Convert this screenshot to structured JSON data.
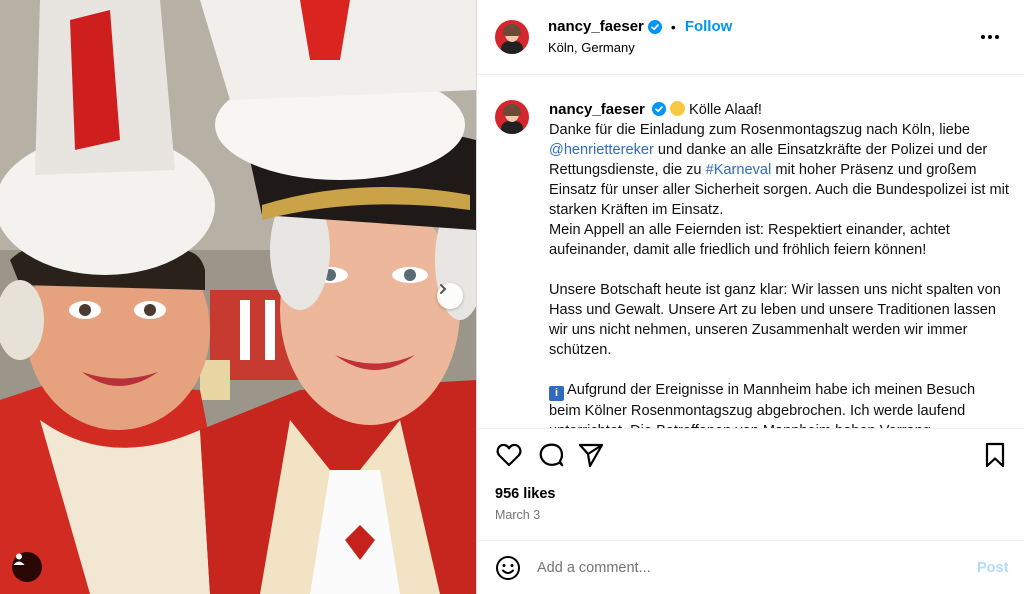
{
  "post": {
    "author": "nancy_faeser",
    "location": "Köln, Germany",
    "separator": "•",
    "follow_label": "Follow",
    "more_label": "•••",
    "caption": {
      "greeting": "Kölle Alaaf!",
      "line1": "Danke für die Einladung zum Rosenmontagszug nach Köln, liebe",
      "mention": "@henriettereker",
      "line2": " und danke an alle Einsatzkräfte der Polizei und der Rettungsdienste, die zu ",
      "hashtag": "#Karneval",
      "line3": " mit hoher Präsenz und großem Einsatz für unser aller Sicherheit sorgen. Auch die Bundespolizei ist mit starken Kräften im Einsatz.",
      "para2": "Mein Appell an alle Feiernden ist: Respektiert einander, achtet aufeinander, damit alle friedlich und fröhlich feiern können!",
      "para3": "Unsere Botschaft heute ist ganz klar: Wir lassen uns nicht spalten von Hass und Gewalt. Unsere Art zu leben und unsere Traditionen lassen wir uns nicht nehmen, unseren Zusammenhalt werden wir immer schützen.",
      "info_icon": "i",
      "para4": "Aufgrund der Ereignisse in Mannheim habe ich meinen Besuch beim Kölner Rosenmontagszug abgebrochen. Ich werde laufend unterrichtet. Die Betroffenen von Mannheim haben Vorrang."
    },
    "likes": "956 likes",
    "date": "March 3",
    "comment_placeholder": "Add a comment...",
    "post_label": "Post"
  },
  "icons": {
    "verified": "verified-badge-icon",
    "heart": "heart-icon",
    "comment": "comment-icon",
    "share": "share-icon",
    "bookmark": "bookmark-icon",
    "emoji": "emoji-icon",
    "next": "chevron-right-icon",
    "tag": "user-tag-icon"
  },
  "colors": {
    "accent": "#0095f6",
    "link": "#2f6cc1",
    "post_disabled": "#b3dbff",
    "muted": "#737373"
  }
}
